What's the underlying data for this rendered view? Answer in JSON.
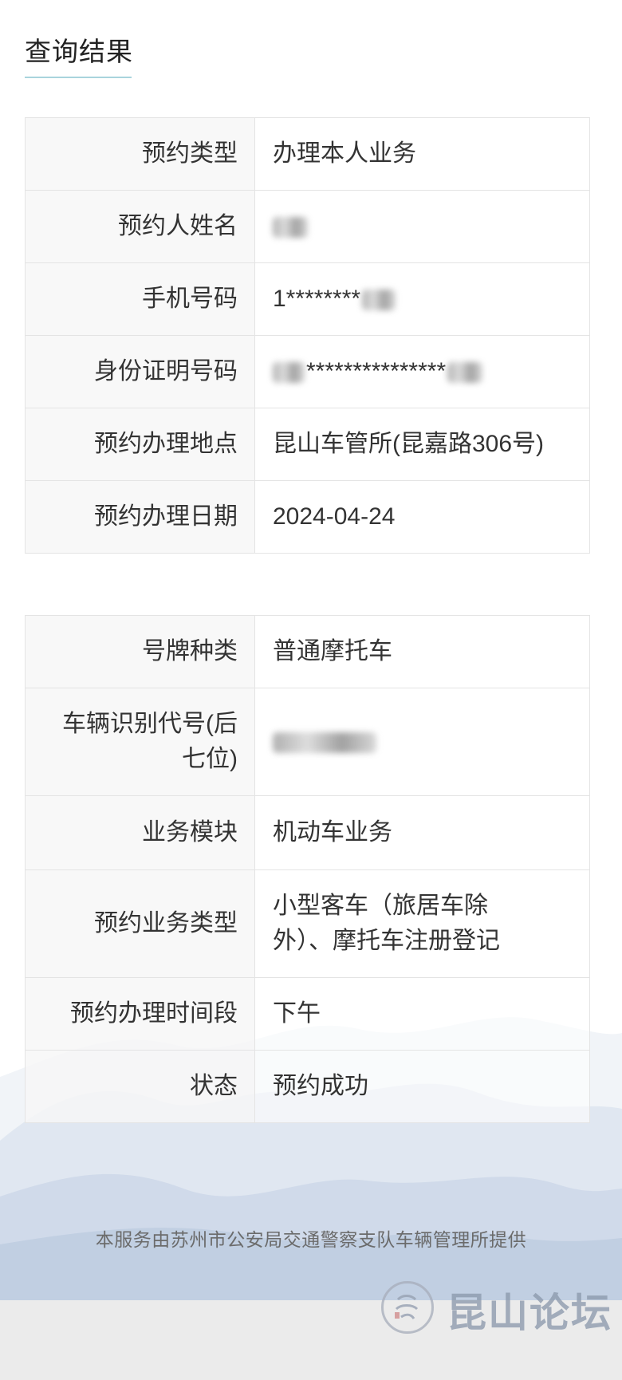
{
  "header": {
    "title": "查询结果"
  },
  "table1": {
    "rows": [
      {
        "label": "预约类型",
        "value": "办理本人业务"
      },
      {
        "label": "预约人姓名",
        "value": "",
        "redacted": "full"
      },
      {
        "label": "手机号码",
        "value": "1********",
        "redacted": "tail"
      },
      {
        "label": "身份证明号码",
        "value": "***************",
        "redacted": "both"
      },
      {
        "label": "预约办理地点",
        "value": "昆山车管所(昆嘉路306号)"
      },
      {
        "label": "预约办理日期",
        "value": "2024-04-24"
      }
    ]
  },
  "table2": {
    "rows": [
      {
        "label": "号牌种类",
        "value": "普通摩托车"
      },
      {
        "label": "车辆识别代号(后七位)",
        "value": "",
        "redacted": "full"
      },
      {
        "label": "业务模块",
        "value": "机动车业务"
      },
      {
        "label": "预约业务类型",
        "value": "小型客车（旅居车除外）、摩托车注册登记"
      },
      {
        "label": "预约办理时间段",
        "value": "下午"
      },
      {
        "label": "状态",
        "value": "预约成功"
      }
    ]
  },
  "footer": {
    "text": "本服务由苏州市公安局交通警察支队车辆管理所提供"
  },
  "watermark": {
    "text": "昆山论坛",
    "icon": "seal-icon"
  },
  "colors": {
    "accent_underline": "#a9d4dd",
    "label_bg": "#f6f6f6",
    "border": "#e4e4e4",
    "bottom_bar": "#ebebeb"
  }
}
